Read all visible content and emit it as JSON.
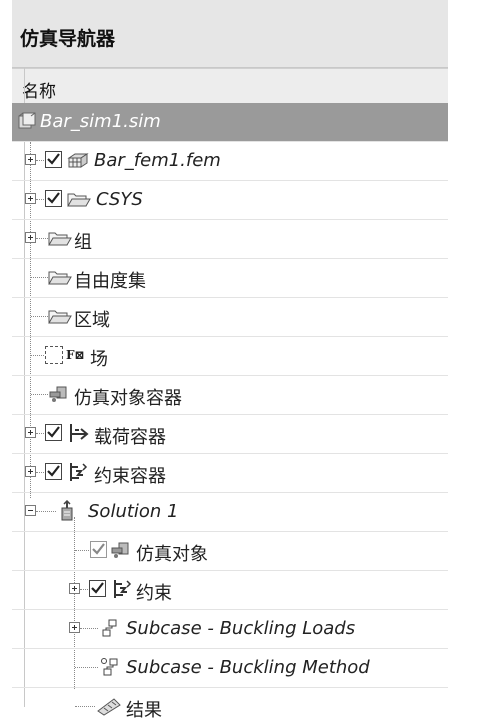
{
  "panel": {
    "title": "仿真导航器",
    "column_header": "名称"
  },
  "tree": {
    "root_label": "Bar_sim1.sim",
    "items": [
      {
        "label": "Bar_fem1.fem"
      },
      {
        "label": "CSYS"
      },
      {
        "label": "组"
      },
      {
        "label": "自由度集"
      },
      {
        "label": "区域"
      },
      {
        "label": "场"
      },
      {
        "label": "仿真对象容器"
      },
      {
        "label": "载荷容器"
      },
      {
        "label": "约束容器"
      },
      {
        "label": "Solution 1"
      },
      {
        "label": "仿真对象"
      },
      {
        "label": "约束"
      },
      {
        "label": "Subcase - Buckling Loads"
      },
      {
        "label": "Subcase - Buckling Method"
      },
      {
        "label": "结果"
      }
    ]
  },
  "field_icon_text": "F⊠"
}
